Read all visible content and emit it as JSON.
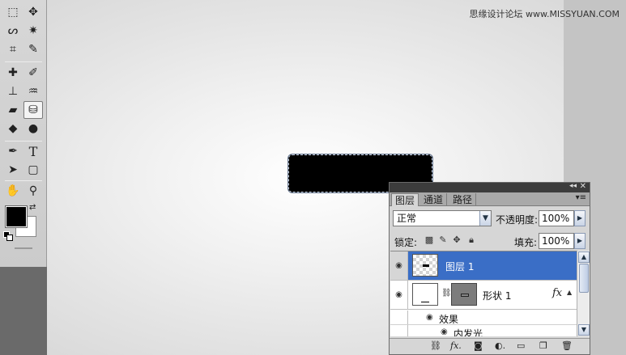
{
  "watermark": "思缘设计论坛 www.MISSYUAN.COM",
  "toolbar": {
    "tools": [
      {
        "name": "marquee-tool-icon",
        "glyph": "⬚"
      },
      {
        "name": "move-tool-icon",
        "glyph": "✥"
      },
      {
        "name": "lasso-tool-icon",
        "glyph": "ᔕ"
      },
      {
        "name": "magic-wand-tool-icon",
        "glyph": "✷"
      },
      {
        "name": "crop-tool-icon",
        "glyph": "⌗"
      },
      {
        "name": "eyedropper-tool-icon",
        "glyph": "✎"
      },
      {
        "name": "healing-brush-tool-icon",
        "glyph": "✚"
      },
      {
        "name": "brush-tool-icon",
        "glyph": "✐"
      },
      {
        "name": "clone-stamp-tool-icon",
        "glyph": "⊥"
      },
      {
        "name": "history-brush-tool-icon",
        "glyph": "♒"
      },
      {
        "name": "eraser-tool-icon",
        "glyph": "▰"
      },
      {
        "name": "paint-bucket-tool-icon",
        "glyph": "⛁"
      },
      {
        "name": "blur-tool-icon",
        "glyph": "💧"
      },
      {
        "name": "dodge-tool-icon",
        "glyph": "●"
      },
      {
        "name": "pen-tool-icon",
        "glyph": "✒"
      },
      {
        "name": "type-tool-icon",
        "glyph": "T"
      },
      {
        "name": "path-selection-tool-icon",
        "glyph": "➤"
      },
      {
        "name": "shape-tool-icon",
        "glyph": "▢"
      },
      {
        "name": "hand-tool-icon",
        "glyph": "✋"
      },
      {
        "name": "zoom-tool-icon",
        "glyph": "🔍"
      }
    ],
    "foreground_color": "#000000",
    "background_color": "#ffffff"
  },
  "layers_panel": {
    "tabs": [
      {
        "label": "图层",
        "active": true
      },
      {
        "label": "通道",
        "active": false
      },
      {
        "label": "路径",
        "active": false
      }
    ],
    "blend_mode": "正常",
    "opacity_label": "不透明度:",
    "opacity_value": "100%",
    "lock_label": "锁定:",
    "fill_label": "填充:",
    "fill_value": "100%",
    "layers": [
      {
        "name": "图层 1",
        "selected": true
      },
      {
        "name": "形状 1",
        "selected": false,
        "fx": "fx"
      }
    ],
    "effects_label": "效果",
    "effect_items": [
      "内发光"
    ],
    "selection_color": "#3a6ec6"
  }
}
